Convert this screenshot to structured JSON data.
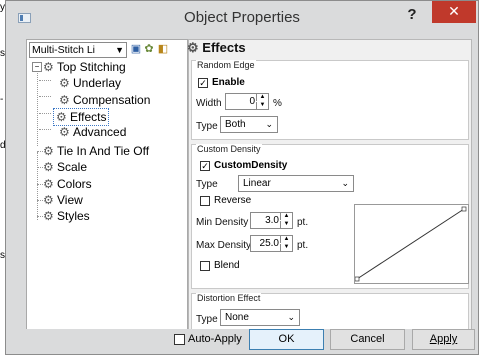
{
  "window": {
    "title": "Object Properties",
    "help_label": "?",
    "close_label": "✕"
  },
  "side_labels": [
    "y",
    "s",
    "-",
    "d",
    "s"
  ],
  "left_pane": {
    "mode_dropdown": "Multi-Stitch Li",
    "tree": [
      {
        "label": "Top Stitching",
        "level": 0,
        "expanded": true
      },
      {
        "label": "Underlay",
        "level": 1
      },
      {
        "label": "Compensation",
        "level": 1
      },
      {
        "label": "Effects",
        "level": 1,
        "selected": true
      },
      {
        "label": "Advanced",
        "level": 1
      },
      {
        "label": "Tie In And Tie Off",
        "level": 0
      },
      {
        "label": "Scale",
        "level": 0
      },
      {
        "label": "Colors",
        "level": 0
      },
      {
        "label": "View",
        "level": 0
      },
      {
        "label": "Styles",
        "level": 0
      }
    ]
  },
  "effects": {
    "header": "Effects",
    "random_edge": {
      "title": "Random Edge",
      "enable_label": "Enable",
      "enable_checked": true,
      "width_label": "Width",
      "width_value": "0",
      "width_unit": "%",
      "type_label": "Type",
      "type_value": "Both"
    },
    "custom_density": {
      "title": "Custom Density",
      "cd_label": "CustomDensity",
      "cd_checked": true,
      "type_label": "Type",
      "type_value": "Linear",
      "reverse_label": "Reverse",
      "reverse_checked": false,
      "min_label": "Min Density",
      "min_value": "3.0",
      "min_unit": "pt.",
      "max_label": "Max Density",
      "max_value": "25.0",
      "max_unit": "pt.",
      "blend_label": "Blend",
      "blend_checked": false
    },
    "distortion": {
      "title": "Distortion Effect",
      "type_label": "Type",
      "type_value": "None"
    }
  },
  "bottom": {
    "auto_apply_label": "Auto-Apply",
    "ok_label": "OK",
    "cancel_label": "Cancel",
    "apply_label": "Apply"
  },
  "colors": {
    "close_red": "#c0392b",
    "accent_blue": "#3c7fb1",
    "background": "#dadbdc"
  }
}
